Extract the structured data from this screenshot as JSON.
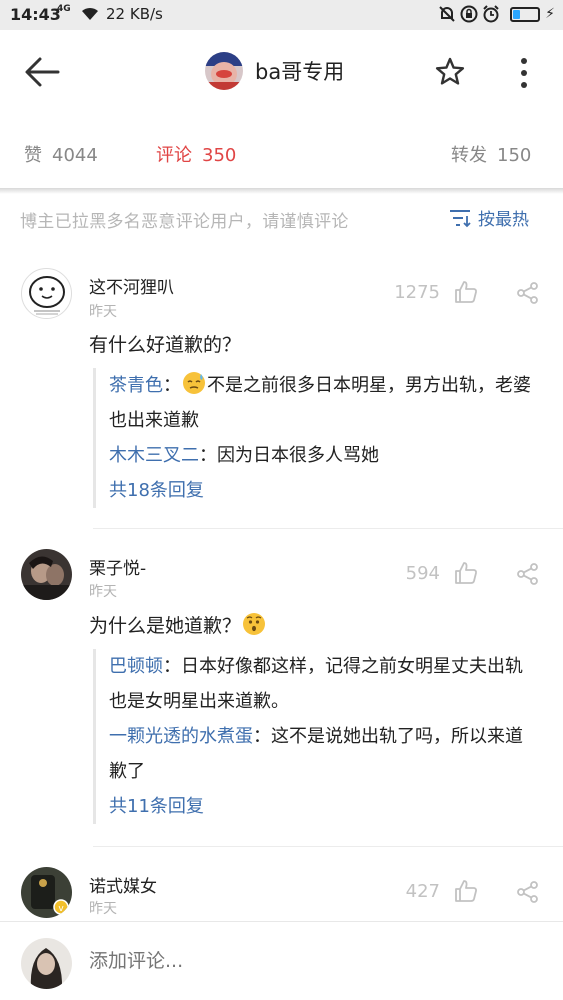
{
  "status_bar": {
    "time": "14:43",
    "network": "4G",
    "speed": "22 KB/s",
    "battery_level": 0.3
  },
  "header": {
    "title": "ba哥专用"
  },
  "stats": {
    "likes_label": "赞",
    "likes_count": "4044",
    "comments_label": "评论",
    "comments_count": "350",
    "reposts_label": "转发",
    "reposts_count": "150"
  },
  "notice": "博主已拉黑多名恶意评论用户，请谨慎评论",
  "sort_label": "按最热",
  "comments": [
    {
      "user": "这不河狸叭",
      "time": "昨天",
      "likes": "1275",
      "text": "有什么好道歉的？",
      "replies": [
        {
          "name": "茶青色",
          "text": "不是之前很多日本明星，男方出轨，老婆也出来道歉"
        },
        {
          "name": "木木三叉二",
          "text": "因为日本很多人骂她"
        }
      ],
      "more": "共18条回复"
    },
    {
      "user": "栗子悦-",
      "time": "昨天",
      "likes": "594",
      "text": "为什么是她道歉？",
      "replies": [
        {
          "name": "巴顿顿",
          "text": "日本好像都这样，记得之前女明星丈夫出轨也是女明星出来道歉。"
        },
        {
          "name": "一颗光透的水煮蛋",
          "text": "这不是说她出轨了吗，所以来道歉了"
        }
      ],
      "more": "共11条回复"
    },
    {
      "user": "诺式媒女",
      "time": "昨天",
      "likes": "427"
    }
  ],
  "input": {
    "placeholder": "添加评论..."
  },
  "colors": {
    "accent_blue": "#3f6fae",
    "accent_red": "#e04545"
  },
  "icons": [
    "back-arrow-icon",
    "star-icon",
    "more-vert-icon",
    "thumb-up-icon",
    "share-icon",
    "sort-icon"
  ]
}
